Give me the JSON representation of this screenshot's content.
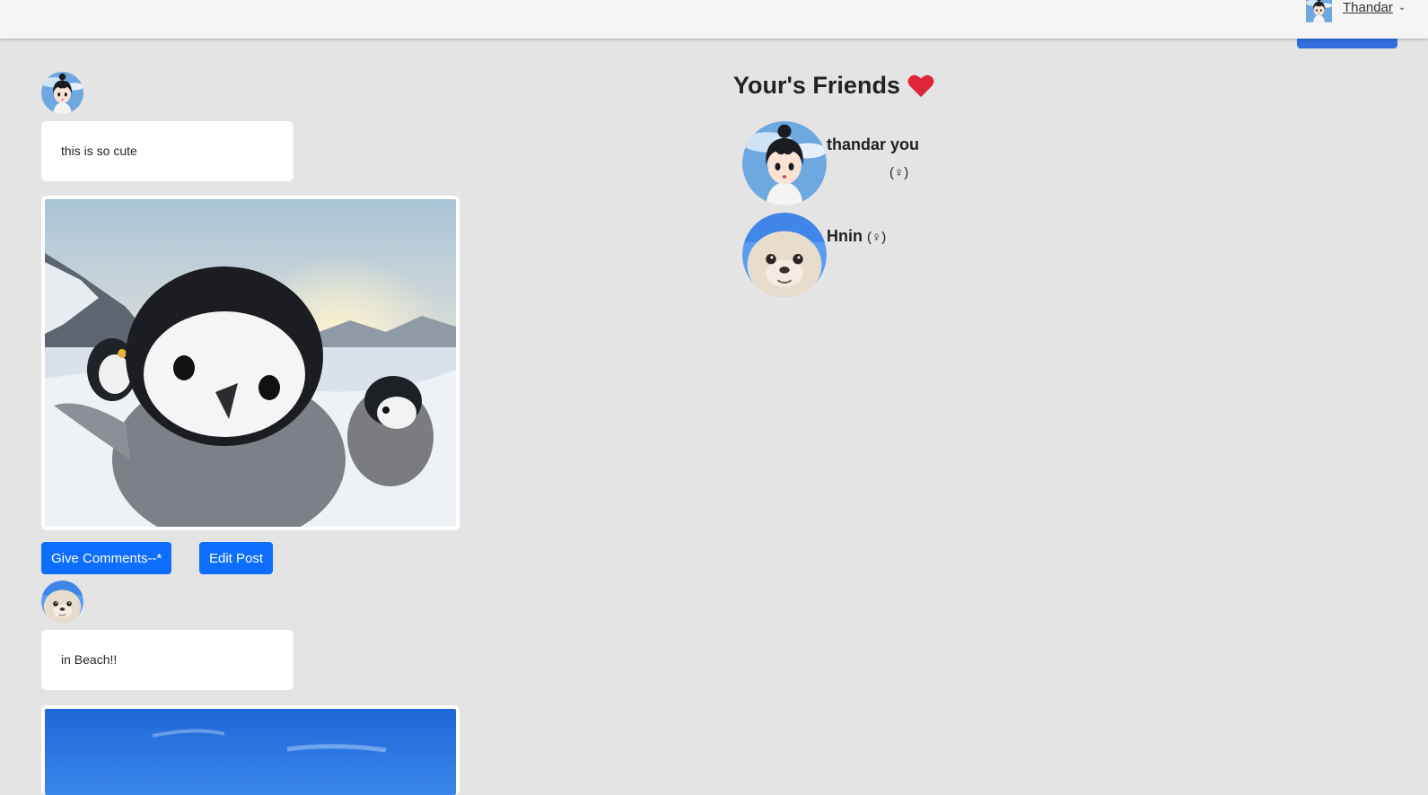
{
  "nav": {
    "user_name": "Thandar"
  },
  "posts": [
    {
      "text": "this is so cute"
    },
    {
      "text": "in Beach!!"
    }
  ],
  "actions": {
    "comment_label": "Give Comments--*",
    "edit_label": "Edit Post"
  },
  "friends": {
    "title": "Your's Friends",
    "list": [
      {
        "name": "thandar you",
        "gender": "(♀)"
      },
      {
        "name": "Hnin",
        "gender": "(♀)"
      }
    ]
  },
  "colors": {
    "primary": "#0d6efd",
    "heart": "#e0243a",
    "page_bg": "#e4e4e4"
  }
}
